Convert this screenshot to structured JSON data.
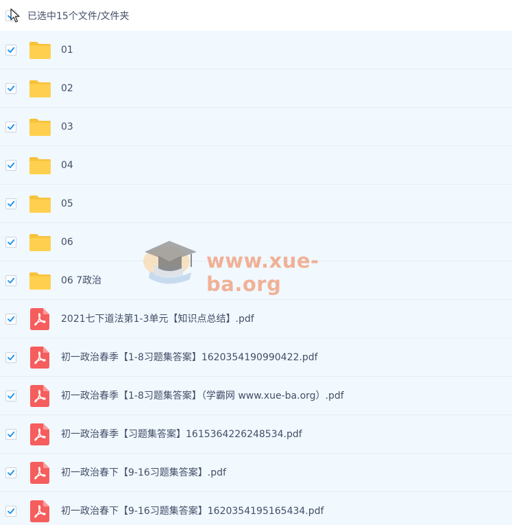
{
  "header": {
    "selection_text": "已选中15个文件/文件夹"
  },
  "colors": {
    "check_blue": "#2196f3",
    "folder_yellow": "#ffd04f",
    "pdf_red": "#f65d5d",
    "row_bg": "#f1f8fe",
    "text": "#424e67"
  },
  "files": [
    {
      "name": "01",
      "type": "folder",
      "icon": "folder-icon"
    },
    {
      "name": "02",
      "type": "folder",
      "icon": "folder-icon"
    },
    {
      "name": "03",
      "type": "folder",
      "icon": "folder-icon"
    },
    {
      "name": "04",
      "type": "folder",
      "icon": "folder-icon"
    },
    {
      "name": "05",
      "type": "folder",
      "icon": "folder-icon"
    },
    {
      "name": "06",
      "type": "folder",
      "icon": "folder-icon"
    },
    {
      "name": "06 7政治",
      "type": "folder",
      "icon": "folder-icon"
    },
    {
      "name": "2021七下道法第1-3单元【知识点总结】.pdf",
      "type": "pdf",
      "icon": "pdf-icon"
    },
    {
      "name": "初一政治春季【1-8习题集答案】1620354190990422.pdf",
      "type": "pdf",
      "icon": "pdf-icon"
    },
    {
      "name": "初一政治春季【1-8习题集答案】（学霸网 www.xue-ba.org）.pdf",
      "type": "pdf",
      "icon": "pdf-icon"
    },
    {
      "name": "初一政治春季【习题集答案】1615364226248534.pdf",
      "type": "pdf",
      "icon": "pdf-icon"
    },
    {
      "name": "初一政治春下【9-16习题集答案】.pdf",
      "type": "pdf",
      "icon": "pdf-icon"
    },
    {
      "name": "初一政治春下【9-16习题集答案】1620354195165434.pdf",
      "type": "pdf",
      "icon": "pdf-icon"
    }
  ],
  "watermark": {
    "text": "www.xue-ba.org"
  }
}
